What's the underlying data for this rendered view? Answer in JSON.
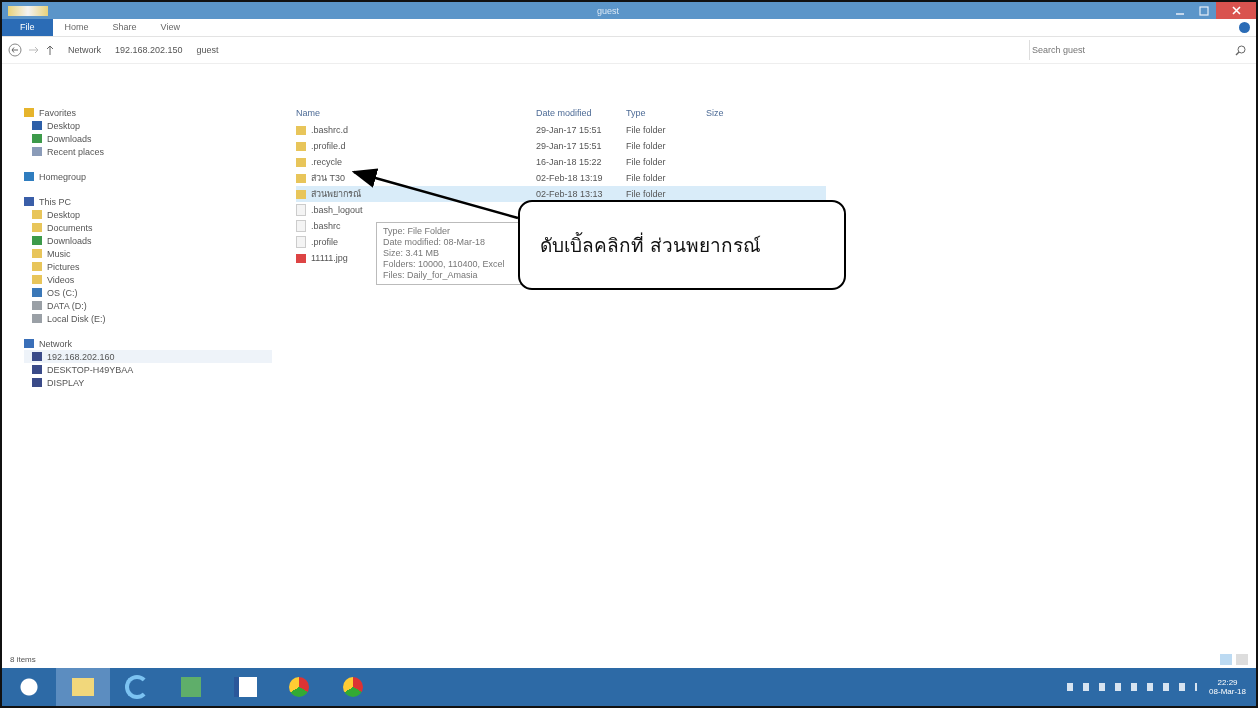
{
  "window": {
    "title": "guest"
  },
  "ribbon_tabs": [
    {
      "label": "File",
      "selected": true
    },
    {
      "label": "Home",
      "selected": false
    },
    {
      "label": "Share",
      "selected": false
    },
    {
      "label": "View",
      "selected": false
    }
  ],
  "breadcrumb": [
    "Network",
    "192.168.202.150",
    "guest"
  ],
  "search": {
    "placeholder": "Search guest"
  },
  "sidebar": {
    "groups": [
      {
        "label": "Favorites",
        "kind": "star",
        "items": [
          {
            "label": "Desktop",
            "kind": "desktop"
          },
          {
            "label": "Downloads",
            "kind": "download"
          },
          {
            "label": "Recent places",
            "kind": "recent"
          }
        ]
      },
      {
        "label": "Homegroup",
        "kind": "home"
      },
      {
        "label": "This PC",
        "kind": "pc",
        "items": [
          {
            "label": "Desktop",
            "kind": "folder"
          },
          {
            "label": "Documents",
            "kind": "folder"
          },
          {
            "label": "Downloads",
            "kind": "download"
          },
          {
            "label": "Music",
            "kind": "folder"
          },
          {
            "label": "Pictures",
            "kind": "folder"
          },
          {
            "label": "Videos",
            "kind": "folder"
          },
          {
            "label": "OS (C:)",
            "kind": "drive"
          },
          {
            "label": "DATA (D:)",
            "kind": "disk"
          },
          {
            "label": "Local Disk (E:)",
            "kind": "disk"
          }
        ]
      },
      {
        "label": "Network",
        "kind": "network",
        "items": [
          {
            "label": "192.168.202.160",
            "kind": "computer",
            "selected": true
          },
          {
            "label": "DESKTOP-H49YBAA",
            "kind": "computer",
            "selected": false
          },
          {
            "label": "DISPLAY",
            "kind": "computer",
            "selected": false
          }
        ]
      }
    ]
  },
  "table": {
    "columns": [
      "Name",
      "Date modified",
      "Type",
      "Size"
    ],
    "rows": [
      {
        "name": ".bashrc.d",
        "date": "29-Jan-17 15:51",
        "type": "File folder",
        "kind": "folder",
        "selected": false
      },
      {
        "name": ".profile.d",
        "date": "29-Jan-17 15:51",
        "type": "File folder",
        "kind": "folder",
        "selected": false
      },
      {
        "name": ".recycle",
        "date": "16-Jan-18 15:22",
        "type": "File folder",
        "kind": "folder",
        "selected": false
      },
      {
        "name": "ส่วน T30",
        "date": "02-Feb-18 13:19",
        "type": "File folder",
        "kind": "folder",
        "selected": false
      },
      {
        "name": "ส่วนพยากรณ์",
        "date": "02-Feb-18 13:13",
        "type": "File folder",
        "kind": "folder",
        "selected": true
      },
      {
        "name": ".bash_logout",
        "kind": "file",
        "selected": false
      },
      {
        "name": ".bashrc",
        "kind": "file",
        "selected": false
      },
      {
        "name": ".profile",
        "kind": "file",
        "selected": false
      },
      {
        "name": "11111.jpg",
        "kind": "image",
        "selected": false
      }
    ]
  },
  "tooltip": [
    "Type: File Folder",
    "Date modified: 08-Mar-18",
    "Size: 3.41 MB",
    "Folders: 10000, 110400, Excel",
    "Files: Daily_for_Amasia"
  ],
  "callout": {
    "text": "ดับเบิ้ลคลิกที่ ส่วนพยากรณ์"
  },
  "status_bar": {
    "count": "8 items"
  },
  "taskbar": {
    "apps": [
      {
        "kind": "start"
      },
      {
        "kind": "explorer"
      },
      {
        "kind": "ie"
      },
      {
        "kind": "excel"
      },
      {
        "kind": "word"
      },
      {
        "kind": "chrome"
      },
      {
        "kind": "chrome"
      }
    ],
    "time": "22:29",
    "date": "08-Mar-18"
  }
}
